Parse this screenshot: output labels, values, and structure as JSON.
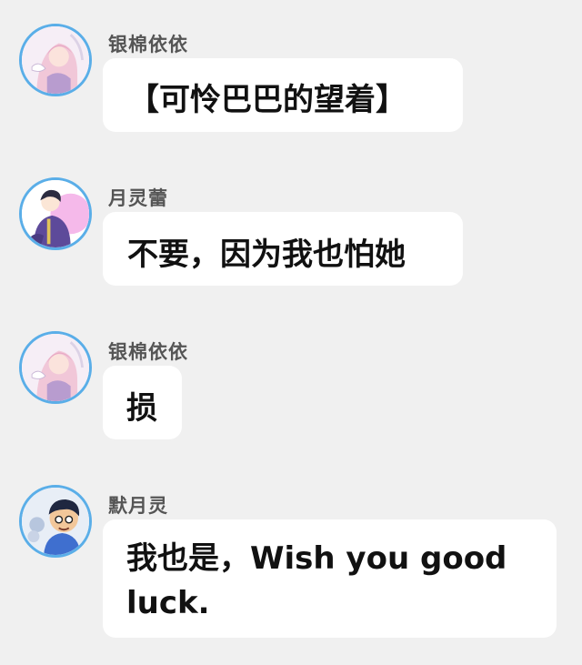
{
  "colors": {
    "background": "#f0f0f0",
    "bubble": "#ffffff",
    "avatar_ring": "#5aaee8",
    "name_text": "#555555",
    "message_text": "#111111"
  },
  "messages": [
    {
      "sender": "银棉依依",
      "text": "【可怜巴巴的望着】",
      "avatar_icon": "pink-haired-girl-avatar"
    },
    {
      "sender": "月灵蕾",
      "text": "不要，因为我也怕她",
      "avatar_icon": "purple-uniform-character-avatar"
    },
    {
      "sender": "银棉依依",
      "text": "损",
      "avatar_icon": "pink-haired-girl-avatar"
    },
    {
      "sender": "默月灵",
      "text": "我也是，Wish you good luck.",
      "avatar_icon": "cartoon-boy-avatar"
    }
  ]
}
